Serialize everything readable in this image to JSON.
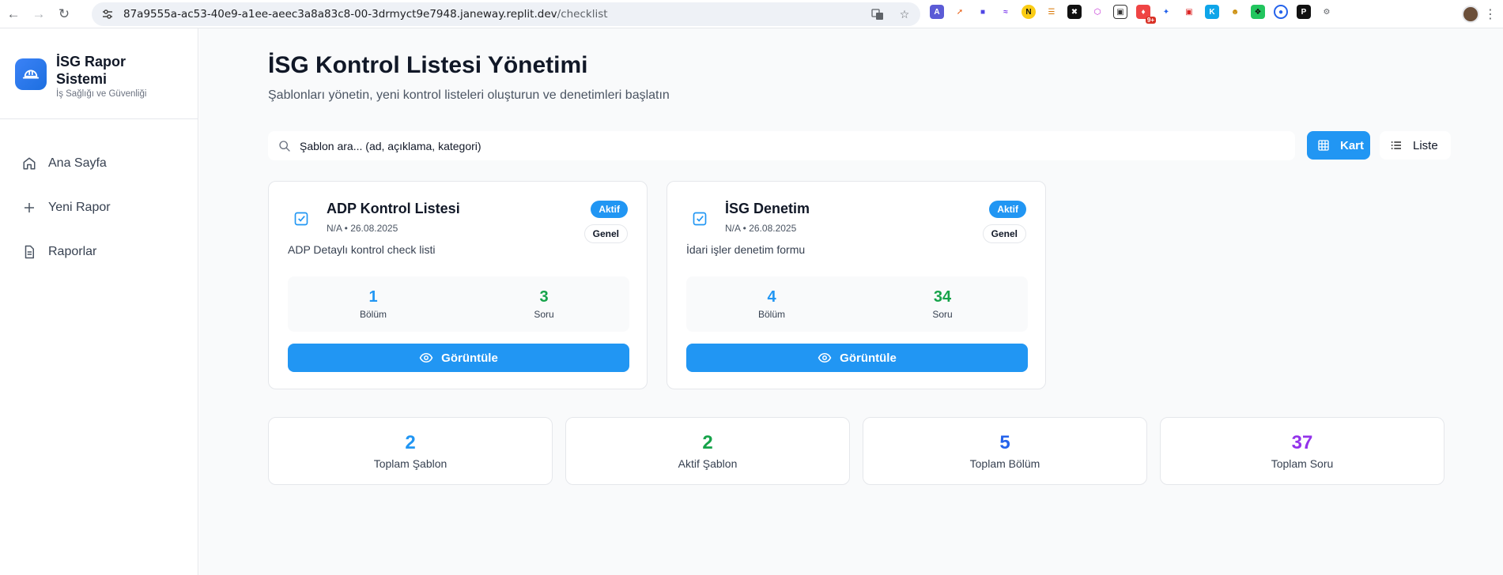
{
  "browser": {
    "url_main": "87a9555a-ac53-40e9-a1ee-aeec3a8a83c8-00-3drmyct9e7948.janeway.replit.dev",
    "url_path": "/checklist",
    "extension_badge": "9+"
  },
  "sidebar": {
    "title": "İSG Rapor Sistemi",
    "subtitle": "İş Sağlığı ve Güvenliği",
    "items": [
      {
        "label": "Ana Sayfa",
        "icon": "home-icon"
      },
      {
        "label": "Yeni Rapor",
        "icon": "plus-icon"
      },
      {
        "label": "Raporlar",
        "icon": "document-icon"
      }
    ]
  },
  "header": {
    "title": "İSG Kontrol Listesi Yönetimi",
    "subtitle": "Şablonları yönetin, yeni kontrol listeleri oluşturun ve denetimleri başlatın"
  },
  "search": {
    "placeholder": "Şablon ara... (ad, açıklama, kategori)"
  },
  "view_toggle": {
    "kart": "Kart",
    "liste": "Liste"
  },
  "cards": [
    {
      "title": "ADP Kontrol Listesi",
      "meta": "N/A • 26.08.2025",
      "description": "ADP Detaylı kontrol check listi",
      "status": "Aktif",
      "category": "Genel",
      "sections": "1",
      "sections_label": "Bölüm",
      "questions": "3",
      "questions_label": "Soru",
      "action": "Görüntüle"
    },
    {
      "title": "İSG Denetim",
      "meta": "N/A • 26.08.2025",
      "description": "İdari işler denetim formu",
      "status": "Aktif",
      "category": "Genel",
      "sections": "4",
      "sections_label": "Bölüm",
      "questions": "34",
      "questions_label": "Soru",
      "action": "Görüntüle"
    }
  ],
  "summary": [
    {
      "value": "2",
      "label": "Toplam Şablon"
    },
    {
      "value": "2",
      "label": "Aktif Şablon"
    },
    {
      "value": "5",
      "label": "Toplam Bölüm"
    },
    {
      "value": "37",
      "label": "Toplam Soru"
    }
  ],
  "colors": {
    "primary": "#2196f3",
    "green": "#16a34a",
    "indigo": "#2563eb",
    "purple": "#9333ea"
  }
}
